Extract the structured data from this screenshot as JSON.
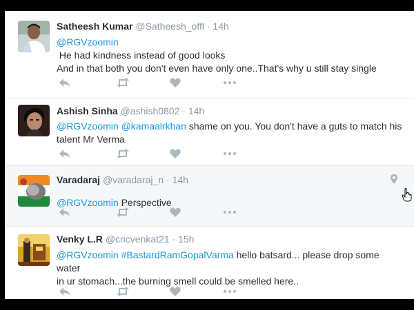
{
  "tweets": [
    {
      "name": "Satheesh Kumar",
      "handle": "@Satheesh_offl",
      "time": "14h",
      "mention": "@RGVzoomin",
      "lines": [
        " He had kindness instead of good looks",
        "And in that both you don't even have only one..That's why u still stay single"
      ]
    },
    {
      "name": "Ashish Sinha",
      "handle": "@ashish0802",
      "time": "14h",
      "mention1": "@RGVzoomin",
      "mention2": "@kamaalrkhan",
      "line1_rest": " shame on you. You don't have a guts to match his",
      "line2": "talent Mr Verma"
    },
    {
      "name": "Varadaraj",
      "handle": "@varadaraj_n",
      "time": "14h",
      "mention": "@RGVzoomin",
      "rest": " Perspective"
    },
    {
      "name": "Venky L.R",
      "handle": "@cricvenkat21",
      "time": "15h",
      "mention": "@RGVzoomin",
      "hashtag": "#BastardRamGopalVarma",
      "line1_rest": " hello batsard... please drop some water",
      "line2": "in ur stomach...the burning smell could be smelled here.."
    }
  ],
  "separator": "·",
  "icons": {
    "reply": "reply-icon",
    "retweet": "retweet-icon",
    "like": "heart-icon",
    "more": "more-icon",
    "location": "location-pin-icon",
    "cursor": "hand-cursor-icon"
  },
  "colors": {
    "link": "#1b95e0",
    "text": "#292f33",
    "muted": "#8899a6",
    "icon": "#aab8c2",
    "hover_bg": "#f5f8fa"
  }
}
